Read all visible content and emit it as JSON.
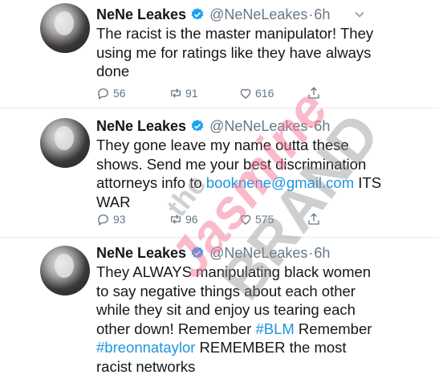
{
  "tweets": [
    {
      "name": "NeNe Leakes",
      "handle": "@NeNeLeakes",
      "time": "6h",
      "lines": [
        [
          {
            "t": "The racist is the master manipulator! They"
          }
        ],
        [
          {
            "t": "using me for ratings like they have always"
          }
        ],
        [
          {
            "t": "done"
          }
        ]
      ],
      "replies": "56",
      "retweets": "91",
      "likes": "616"
    },
    {
      "name": "NeNe Leakes",
      "handle": "@NeNeLeakes",
      "time": "6h",
      "lines": [
        [
          {
            "t": "They gone leave my name outta these"
          }
        ],
        [
          {
            "t": "shows. Send me your best discrimination"
          }
        ],
        [
          {
            "t": "attorneys info to "
          },
          {
            "t": "booknene@gmail.com",
            "link": true
          },
          {
            "t": " ITS"
          }
        ],
        [
          {
            "t": "WAR"
          }
        ]
      ],
      "replies": "93",
      "retweets": "96",
      "likes": "575"
    },
    {
      "name": "NeNe Leakes",
      "handle": "@NeNeLeakes",
      "time": "6h",
      "lines": [
        [
          {
            "t": "They ALWAYS manipulating black women"
          }
        ],
        [
          {
            "t": "to say negative things about each other"
          }
        ],
        [
          {
            "t": "while they sit and enjoy us tearing each"
          }
        ],
        [
          {
            "t": "other down! Remember "
          },
          {
            "t": "#BLM",
            "link": true
          },
          {
            "t": " Remember"
          }
        ],
        [
          {
            "t": "#breonnataylor",
            "link": true
          },
          {
            "t": " REMEMBER the most"
          }
        ],
        [
          {
            "t": "racist networks"
          }
        ]
      ]
    }
  ],
  "watermark": {
    "line1": "the",
    "line2": "Jasmine",
    "line3": "BRAND"
  },
  "colors": {
    "link": "#1b95e0",
    "verified": "#1da1f2",
    "muted": "#657786",
    "text": "#14171a"
  },
  "icons": {
    "verified": "verified-badge-icon",
    "caret": "chevron-down-icon",
    "reply": "reply-icon",
    "retweet": "retweet-icon",
    "like": "heart-icon",
    "share": "share-icon"
  }
}
